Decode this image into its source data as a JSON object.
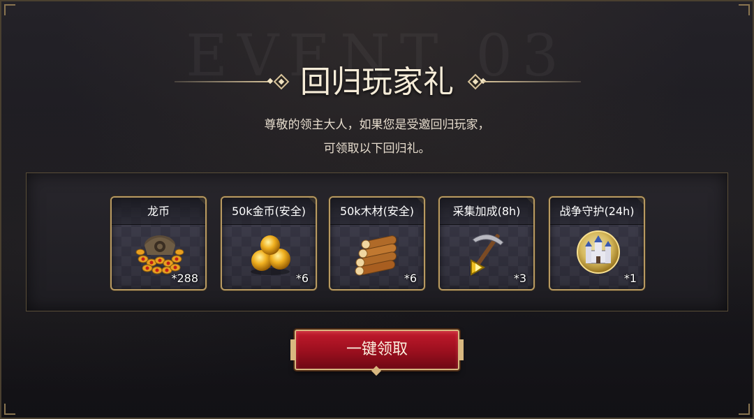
{
  "header": {
    "watermark": "EVENT 03",
    "title": "回归玩家礼",
    "subtitle_line1": "尊敬的领主大人，如果您是受邀回归玩家，",
    "subtitle_line2": "可领取以下回归礼。"
  },
  "rewards": [
    {
      "label": "龙币",
      "count": "*288",
      "icon": "dragon-coin-pile-icon"
    },
    {
      "label": "50k金币(安全)",
      "count": "*6",
      "icon": "gold-coins-icon"
    },
    {
      "label": "50k木材(安全)",
      "count": "*6",
      "icon": "wood-logs-icon"
    },
    {
      "label": "采集加成(8h)",
      "count": "*3",
      "icon": "pickaxe-icon"
    },
    {
      "label": "战争守护(24h)",
      "count": "*1",
      "icon": "castle-shield-icon"
    }
  ],
  "claim_button": {
    "label": "一键领取"
  },
  "colors": {
    "accent_gold": "#b89a62",
    "button_red": "#b01424",
    "title": "#f6ecd8"
  }
}
